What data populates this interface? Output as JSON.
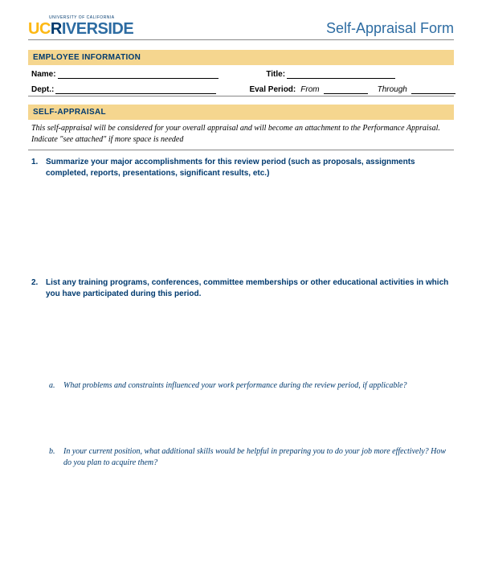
{
  "header": {
    "logo_top": "UNIVERSITY OF CALIFORNIA",
    "logo_uc": "UC",
    "logo_r": "R",
    "logo_rest": "IVERSIDE",
    "form_title": "Self-Appraisal Form"
  },
  "sections": {
    "employee_info": "EMPLOYEE INFORMATION",
    "self_appraisal": "SELF-APPRAISAL"
  },
  "fields": {
    "name_label": "Name:",
    "title_label": "Title:",
    "dept_label": "Dept.:",
    "eval_label": "Eval Period:",
    "from_label": "From",
    "through_label": "Through"
  },
  "instruction": "This self-appraisal will be considered for your overall appraisal and will become an attachment to the Performance Appraisal. Indicate \"see attached\" if more space is needed",
  "questions": {
    "q1_num": "1.",
    "q1_text": "Summarize your major accomplishments for this review period (such as proposals, assignments completed, reports, presentations, significant results, etc.)",
    "q2_num": "2.",
    "q2_text": "List any training programs, conferences, committee memberships or other educational activities in which you have participated during this period.",
    "qa_num": "a.",
    "qa_text": "What problems and constraints influenced your work performance during the review period, if applicable?",
    "qb_num": "b.",
    "qb_text": "In your current position, what additional skills would be helpful in preparing you to do your job more effectively? How do you plan to acquire them?"
  }
}
